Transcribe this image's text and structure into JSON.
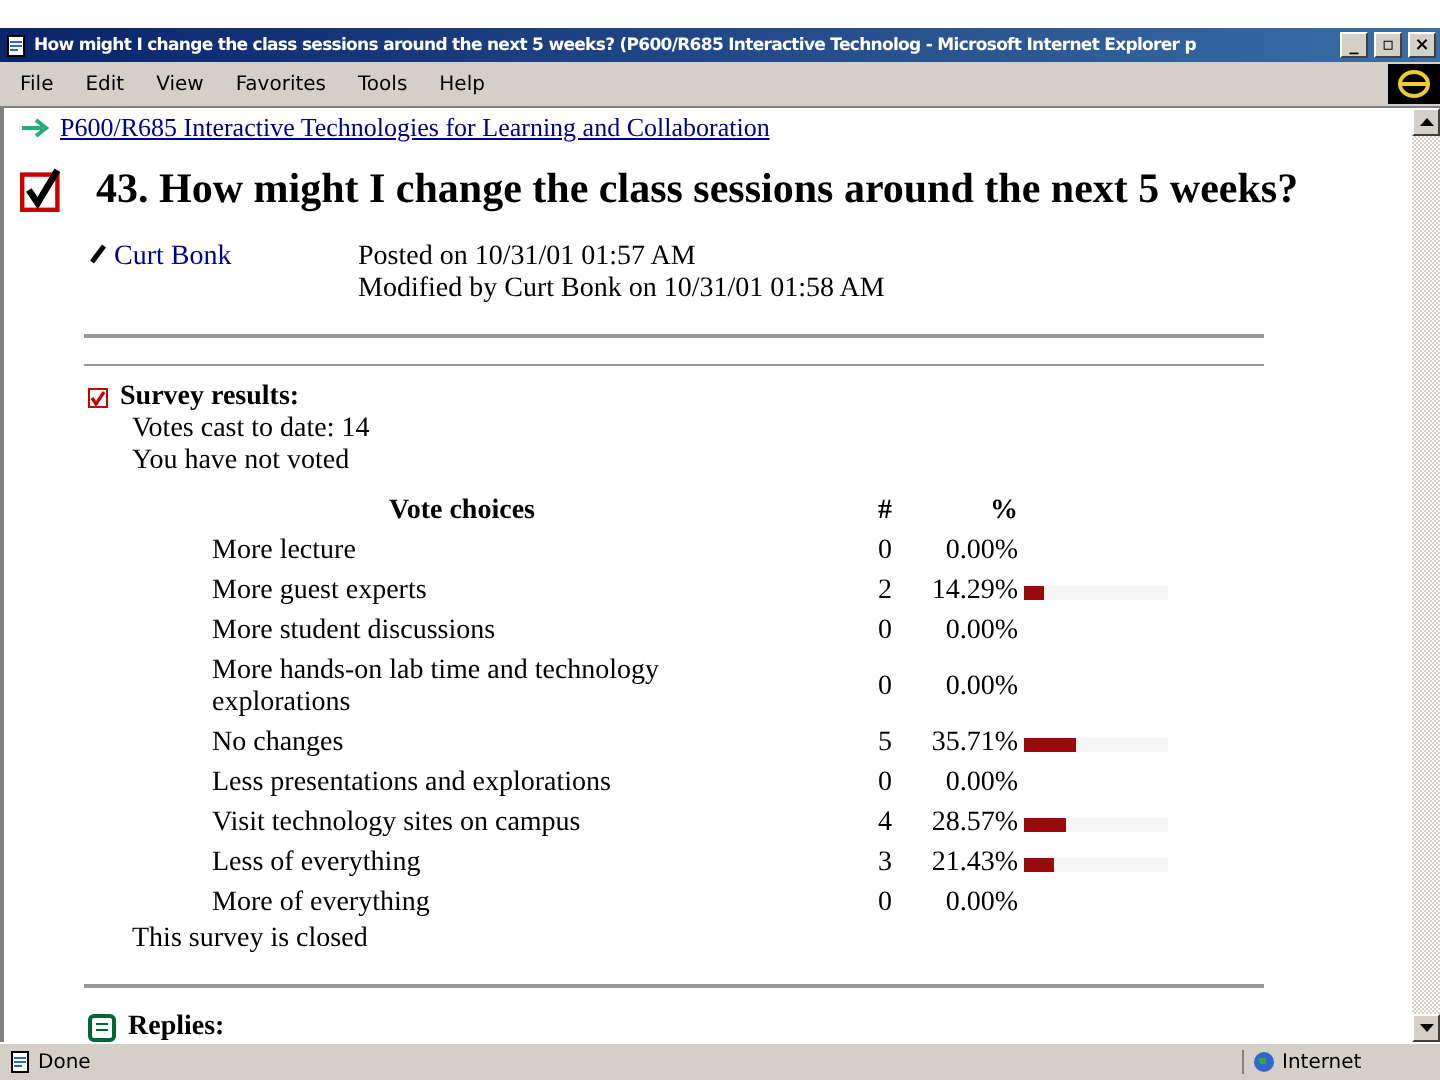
{
  "window": {
    "title": "How might I change the class sessions around the next 5 weeks? (P600/R685 Interactive Technolog - Microsoft Internet Explorer p",
    "controls": [
      "_",
      "▫",
      "×"
    ]
  },
  "menu": [
    "File",
    "Edit",
    "View",
    "Favorites",
    "Tools",
    "Help"
  ],
  "page": {
    "breadcrumb": "P600/R685 Interactive Technologies for Learning and Collaboration",
    "heading": "43. How might I change the class sessions around the next 5 weeks?",
    "author": "Curt Bonk",
    "posted": "Posted on 10/31/01 01:57 AM",
    "modified": "Modified by Curt Bonk on 10/31/01 01:58 AM",
    "survey": {
      "title": "Survey results:",
      "votes": "Votes cast to date: 14",
      "status": "You have not voted",
      "columns": [
        "Vote choices",
        "#",
        "%"
      ],
      "rows": [
        {
          "choice": "More lecture",
          "count": "0",
          "percent": "0.00%"
        },
        {
          "choice": "More guest experts",
          "count": "2",
          "percent": "14.29%",
          "level": 0.1429
        },
        {
          "choice": "More student discussions",
          "count": "0",
          "percent": "0.00%"
        },
        {
          "choice": "More hands-on lab time and technology explorations",
          "count": "0",
          "percent": "0.00%"
        },
        {
          "choice": "No changes",
          "count": "5",
          "percent": "35.71%",
          "level": 0.3571
        },
        {
          "choice": "Less presentations and explorations",
          "count": "0",
          "percent": "0.00%"
        },
        {
          "choice": "Visit technology sites on campus",
          "count": "4",
          "percent": "28.57%",
          "level": 0.2857
        },
        {
          "choice": "Less of everything",
          "count": "3",
          "percent": "21.43%",
          "level": 0.2143
        },
        {
          "choice": "More of everything",
          "count": "0",
          "percent": "0.00%"
        }
      ],
      "closed": "This survey is closed"
    },
    "replies": "Replies:"
  },
  "status_bar": {
    "text": "Done",
    "zone": "Internet"
  }
}
